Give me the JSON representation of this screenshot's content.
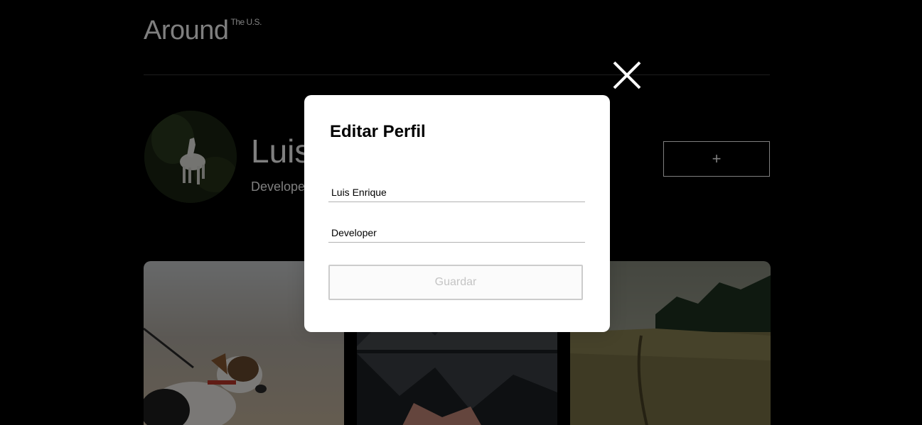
{
  "header": {
    "logo_text": "Around",
    "logo_sup": "The U.S."
  },
  "profile": {
    "name": "Luis Enrique",
    "about": "Developer",
    "add_button_label": "+"
  },
  "modal": {
    "title": "Editar Perfil",
    "name_value": "Luis Enrique",
    "about_value": "Developer",
    "save_label": "Guardar",
    "close_icon": "close-icon"
  },
  "colors": {
    "background": "#000000",
    "modal_background": "#ffffff",
    "save_disabled_text": "#c4c4c4"
  }
}
